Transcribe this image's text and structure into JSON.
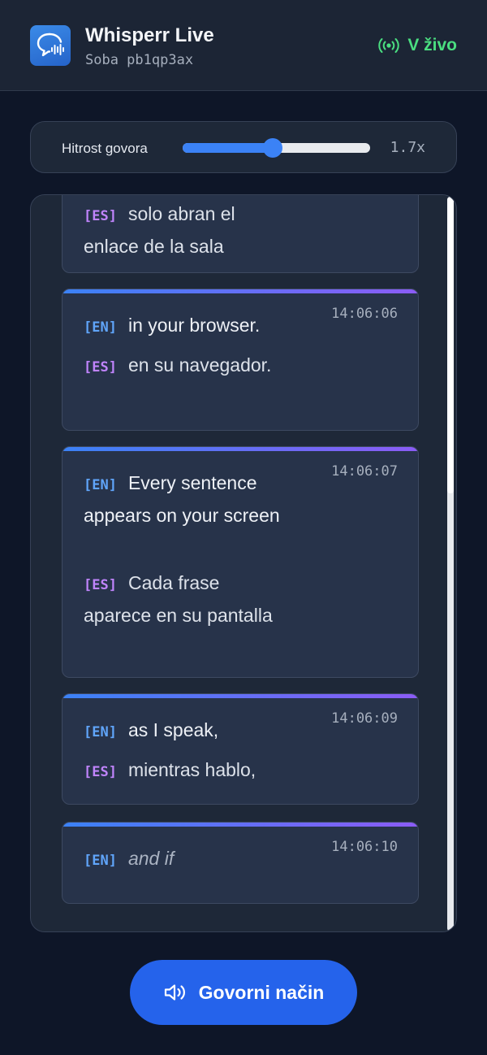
{
  "header": {
    "app_title": "Whisperr Live",
    "room_id": "Soba pb1qp3ax",
    "status_label": "V živo",
    "logo_icon": "chat-bubble-waveform-icon",
    "status_icon": "broadcast-icon"
  },
  "speed": {
    "label": "Hitrost govora",
    "value": 1.7,
    "value_label": "1.7x",
    "slider_fraction": 0.48
  },
  "feed": {
    "cards": [
      {
        "time": "",
        "en": "",
        "es": "solo abran el enlace de la sala",
        "partial_top": true
      },
      {
        "time": "14:06:06",
        "en": "in your browser.",
        "es": "en su navegador."
      },
      {
        "time": "14:06:07",
        "en": "Every sentence appears on your screen",
        "es": "Cada frase aparece en su pantalla"
      },
      {
        "time": "14:06:09",
        "en": "as I speak,",
        "es": "mientras hablo,"
      },
      {
        "time": "14:06:10",
        "en": "and if",
        "es": "",
        "pending": true
      }
    ],
    "lang_tags": {
      "en": "[EN]",
      "es": "[ES]"
    }
  },
  "speak_button": {
    "label": "Govorni način",
    "icon": "speaker-icon"
  },
  "colors": {
    "accent": "#2563eb",
    "live": "#4ade80",
    "en_tag": "#60a5fa",
    "es_tag": "#c084fc"
  }
}
